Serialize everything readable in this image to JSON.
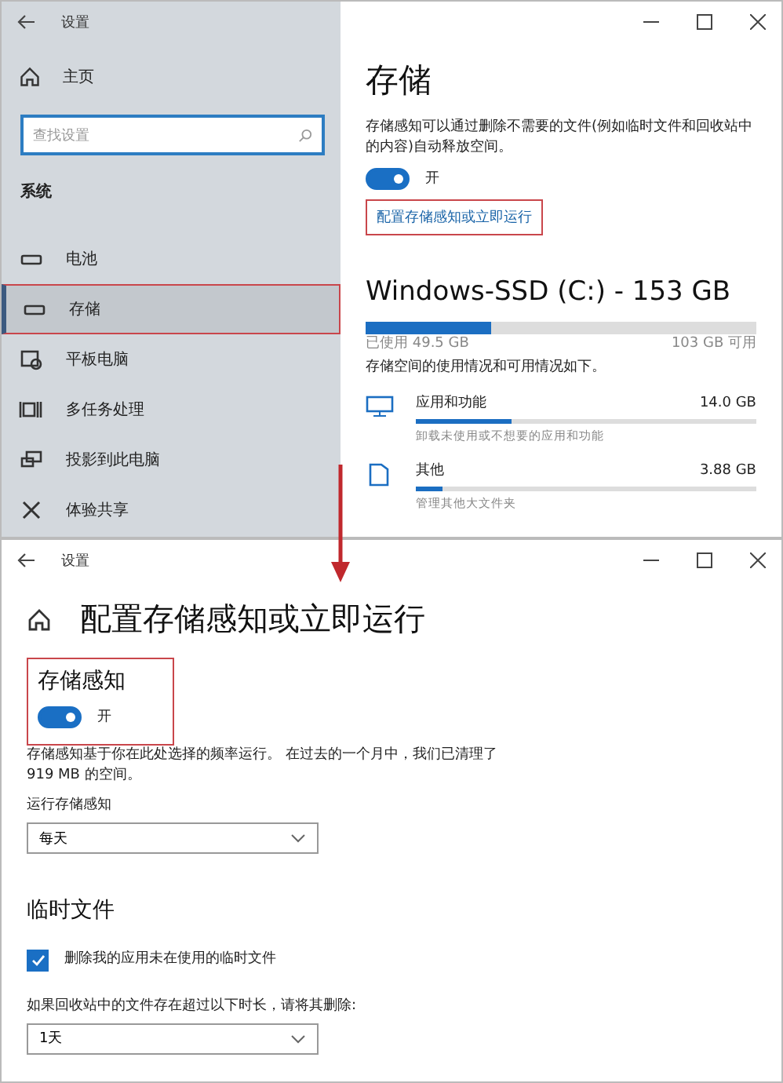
{
  "storage_window": {
    "title": "设置",
    "home": "主页",
    "search": {
      "placeholder": "查找设置"
    },
    "section": "系统",
    "sidebar": {
      "items": [
        {
          "label": "电池",
          "kind": "battery",
          "selected": false,
          "highlighted": false
        },
        {
          "label": "存储",
          "kind": "storage",
          "selected": true,
          "highlighted": true
        },
        {
          "label": "平板电脑",
          "kind": "tablet",
          "selected": false,
          "highlighted": false
        },
        {
          "label": "多任务处理",
          "kind": "multitask",
          "selected": false,
          "highlighted": false
        },
        {
          "label": "投影到此电脑",
          "kind": "project",
          "selected": false,
          "highlighted": false
        },
        {
          "label": "体验共享",
          "kind": "share",
          "selected": false,
          "highlighted": false
        }
      ]
    },
    "heading": "存储",
    "description": "存储感知可以通过删除不需要的文件(例如临时文件和回收站中的内容)自动释放空间。",
    "toggle": {
      "on": true,
      "label": "开"
    },
    "link": {
      "label": "配置存储感知或立即运行",
      "highlighted": true
    },
    "drive": {
      "title": "Windows-SSD (C:) - 153 GB",
      "level": 0.32,
      "used": "已使用 49.5 GB",
      "free": "103 GB 可用",
      "note": "存储空间的使用情况和可用情况如下。",
      "categories": [
        {
          "kind": "apps",
          "name": "应用和功能",
          "size": "14.0 GB",
          "level": 0.28,
          "hint": "卸载未使用或不想要的应用和功能"
        },
        {
          "kind": "other",
          "name": "其他",
          "size": "3.88 GB",
          "level": 0.08,
          "hint": "管理其他大文件夹"
        }
      ]
    }
  },
  "sense_window": {
    "title": "设置",
    "heading": "配置存储感知或立即运行",
    "sense": {
      "title": "存储感知",
      "highlighted": true,
      "toggle": {
        "on": true,
        "label": "开"
      },
      "description": "存储感知基于你在此处选择的频率运行。 在过去的一个月中，我们已清理了 919 MB 的空间。",
      "run_label": "运行存储感知",
      "run_value": "每天"
    },
    "temp": {
      "title": "临时文件",
      "checkbox": {
        "checked": true,
        "label": "删除我的应用未在使用的临时文件"
      },
      "recycle_label": "如果回收站中的文件存在超过以下时长，请将其删除:",
      "recycle_value": "1天"
    }
  }
}
